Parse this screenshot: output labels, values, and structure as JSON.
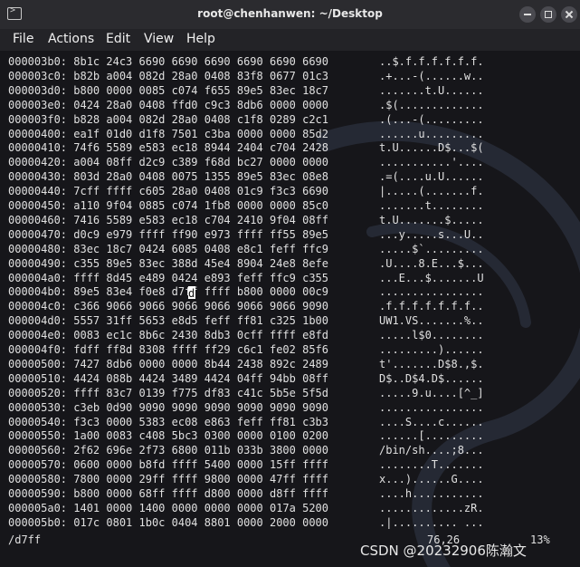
{
  "window": {
    "title": "root@chenhanwen: ~/Desktop"
  },
  "menu": {
    "items": [
      "File",
      "Actions",
      "Edit",
      "View",
      "Help"
    ]
  },
  "hexdump": {
    "rows": [
      {
        "hex": "000003b0: 8b1c 24c3 6690 6690 6690 6690 6690 6690",
        "ascii": "..$.f.f.f.f.f.f."
      },
      {
        "hex": "000003c0: b82b a004 082d 28a0 0408 83f8 0677 01c3",
        "ascii": ".+...-(......w.."
      },
      {
        "hex": "000003d0: b800 0000 0085 c074 f655 89e5 83ec 18c7",
        "ascii": ".......t.U......"
      },
      {
        "hex": "000003e0: 0424 28a0 0408 ffd0 c9c3 8db6 0000 0000",
        "ascii": ".$(............."
      },
      {
        "hex": "000003f0: b828 a004 082d 28a0 0408 c1f8 0289 c2c1",
        "ascii": ".(...-(........."
      },
      {
        "hex": "00000400: ea1f 01d0 d1f8 7501 c3ba 0000 0000 85d2",
        "ascii": "......u........."
      },
      {
        "hex": "00000410: 74f6 5589 e583 ec18 8944 2404 c704 2428",
        "ascii": "t.U......D$...$("
      },
      {
        "hex": "00000420: a004 08ff d2c9 c389 f68d bc27 0000 0000",
        "ascii": "...........'...."
      },
      {
        "hex": "00000430: 803d 28a0 0408 0075 1355 89e5 83ec 08e8",
        "ascii": ".=(....u.U......"
      },
      {
        "hex": "00000440: 7cff ffff c605 28a0 0408 01c9 f3c3 6690",
        "ascii": "|.....(.......f."
      },
      {
        "hex": "00000450: a110 9f04 0885 c074 1fb8 0000 0000 85c0",
        "ascii": ".......t........"
      },
      {
        "hex": "00000460: 7416 5589 e583 ec18 c704 2410 9f04 08ff",
        "ascii": "t.U.......$....."
      },
      {
        "hex": "00000470: d0c9 e979 ffff ff90 e973 ffff ff55 89e5",
        "ascii": "...y.....s...U.."
      },
      {
        "hex": "00000480: 83ec 18c7 0424 6085 0408 e8c1 feff ffc9",
        "ascii": ".....$`........."
      },
      {
        "hex": "00000490: c355 89e5 83ec 388d 45e4 8904 24e8 8efe",
        "ascii": ".U....8.E...$..."
      },
      {
        "hex": "000004a0: ffff 8d45 e489 0424 e893 feff ffc9 c355",
        "ascii": "...E...$.......U"
      },
      {
        "hex": "000004b0: 89e5 83e4 f0e8 d7ff ffff b800 0000 00c9",
        "ascii": "................"
      },
      {
        "hex": "000004c0: c366 9066 9066 9066 9066 9066 9066 9090",
        "ascii": ".f.f.f.f.f.f.f.."
      },
      {
        "hex": "000004d0: 5557 31ff 5653 e8d5 feff ff81 c325 1b00",
        "ascii": "UW1.VS.......%.."
      },
      {
        "hex": "000004e0: 0083 ec1c 8b6c 2430 8db3 0cff ffff e8fd",
        "ascii": ".....l$0........"
      },
      {
        "hex": "000004f0: fdff ff8d 8308 ffff ff29 c6c1 fe02 85f6",
        "ascii": ".........)......"
      },
      {
        "hex": "00000500: 7427 8db6 0000 0000 8b44 2438 892c 2489",
        "ascii": "t'.......D$8.,$."
      },
      {
        "hex": "00000510: 4424 088b 4424 3489 4424 04ff 94bb 08ff",
        "ascii": "D$..D$4.D$......"
      },
      {
        "hex": "00000520: ffff 83c7 0139 f775 df83 c41c 5b5e 5f5d",
        "ascii": ".....9.u....[^_]"
      },
      {
        "hex": "00000530: c3eb 0d90 9090 9090 9090 9090 9090 9090",
        "ascii": "................"
      },
      {
        "hex": "00000540: f3c3 0000 5383 ec08 e863 feff ff81 c3b3",
        "ascii": "....S....c......"
      },
      {
        "hex": "00000550: 1a00 0083 c408 5bc3 0300 0000 0100 0200",
        "ascii": "......[........."
      },
      {
        "hex": "00000560: 2f62 696e 2f73 6800 011b 033b 3800 0000",
        "ascii": "/bin/sh....;8..."
      },
      {
        "hex": "00000570: 0600 0000 b8fd ffff 5400 0000 15ff ffff",
        "ascii": "........T......."
      },
      {
        "hex": "00000580: 7800 0000 29ff ffff 9800 0000 47ff ffff",
        "ascii": "x...)......G...."
      },
      {
        "hex": "00000590: b800 0000 68ff ffff d800 0000 d8ff ffff",
        "ascii": "....h..........."
      },
      {
        "hex": "000005a0: 1401 0000 1400 0000 0000 0000 017a 5200",
        "ascii": ".............zR."
      },
      {
        "hex": "000005b0: 017c 0801 1b0c 0404 8801 0000 2000 0000",
        "ascii": ".|.......... ..."
      }
    ],
    "cursor_char": "d"
  },
  "statusline": {
    "command": "/d7ff",
    "position": "76,26",
    "percent": "13%"
  },
  "watermark": "CSDN @20232906陈瀚文"
}
